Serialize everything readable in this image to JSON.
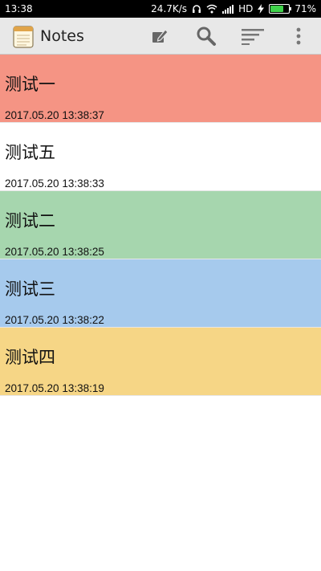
{
  "status_bar": {
    "time": "13:38",
    "network_speed": "24.7K/s",
    "network_label": "HD",
    "battery_percent": "71%",
    "battery_level": 0.71,
    "battery_color": "#3fd24a"
  },
  "app_bar": {
    "title": "Notes",
    "icons": [
      "notes-app-icon",
      "new-note-icon",
      "search-icon",
      "sort-icon",
      "more-icon"
    ]
  },
  "notes": [
    {
      "title": "测试一",
      "date": "2017.05.20 13:38:37",
      "color": "#f59484"
    },
    {
      "title": "测试五",
      "date": "2017.05.20 13:38:33",
      "color": "#ffffff"
    },
    {
      "title": "测试二",
      "date": "2017.05.20 13:38:25",
      "color": "#a6d6ae"
    },
    {
      "title": "测试三",
      "date": "2017.05.20 13:38:22",
      "color": "#a6caed"
    },
    {
      "title": "测试四",
      "date": "2017.05.20 13:38:19",
      "color": "#f6d686"
    }
  ]
}
